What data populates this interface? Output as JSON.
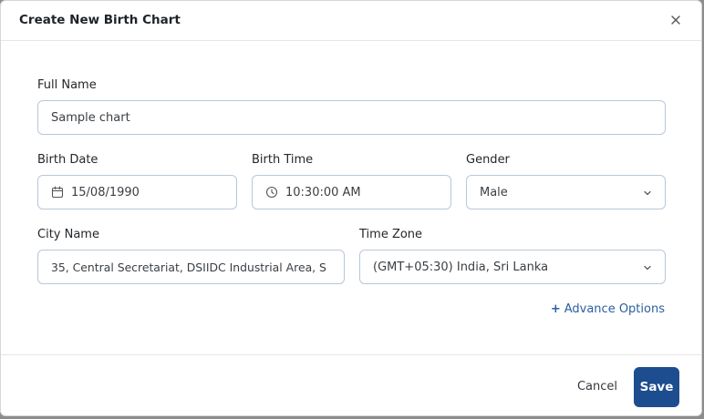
{
  "dialog": {
    "title": "Create New Birth Chart"
  },
  "form": {
    "full_name": {
      "label": "Full Name",
      "value": "Sample chart"
    },
    "birth_date": {
      "label": "Birth Date",
      "value": "15/08/1990",
      "icon": "calendar-icon"
    },
    "birth_time": {
      "label": "Birth Time",
      "value": "10:30:00 AM",
      "icon": "clock-icon"
    },
    "gender": {
      "label": "Gender",
      "value": "Male"
    },
    "city_name": {
      "label": "City Name",
      "value": "35, Central Secretariat, DSIIDC Industrial Area, S"
    },
    "time_zone": {
      "label": "Time Zone",
      "value": "(GMT+05:30) India, Sri Lanka"
    },
    "advance_options": {
      "plus": "+",
      "label": "Advance Options"
    }
  },
  "footer": {
    "cancel_label": "Cancel",
    "save_label": "Save"
  },
  "colors": {
    "primary": "#1d4d8f",
    "link": "#2a5ea0",
    "border": "#b8c7d9"
  }
}
